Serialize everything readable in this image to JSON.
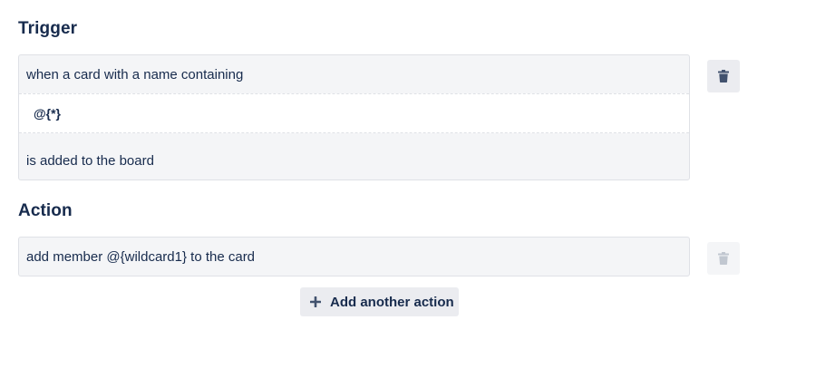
{
  "trigger": {
    "heading": "Trigger",
    "line1": "when a card with a name containing",
    "pattern_value": "@{*}",
    "line2": "is added to the board",
    "delete_icon": "trash-icon"
  },
  "action": {
    "heading": "Action",
    "line1": "add member @{wildcard1} to the card",
    "delete_icon": "trash-icon",
    "delete_disabled": true,
    "add_button_label": "Add another action",
    "add_button_icon": "plus-icon"
  },
  "colors": {
    "text": "#172b4d",
    "box_background": "#f4f5f7",
    "button_background": "#ebecf0",
    "trash_active": "#42526e",
    "trash_disabled": "#c1c7d0"
  }
}
